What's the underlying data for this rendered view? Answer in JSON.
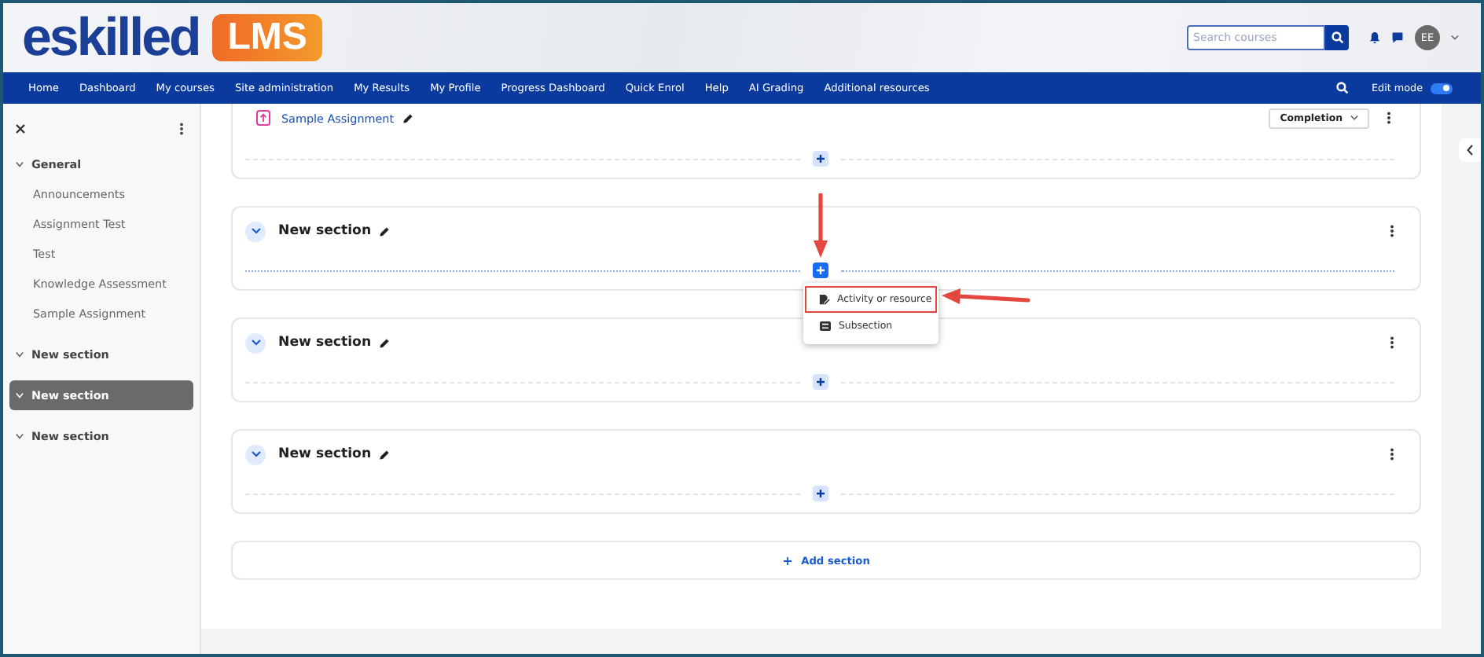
{
  "header": {
    "logo_text": "eskilled",
    "logo_badge": "LMS",
    "search": {
      "placeholder": "Search courses"
    },
    "avatar": "EE"
  },
  "nav": {
    "items": [
      "Home",
      "Dashboard",
      "My courses",
      "Site administration",
      "My Results",
      "My Profile",
      "Progress Dashboard",
      "Quick Enrol",
      "Help",
      "AI Grading",
      "Additional resources"
    ],
    "edit_mode": {
      "label": "Edit mode",
      "on": true
    }
  },
  "sidebar": {
    "items": [
      {
        "label": "General",
        "expanded": true,
        "selected": false,
        "children": [
          {
            "label": "Announcements"
          },
          {
            "label": "Assignment Test"
          },
          {
            "label": "Test"
          },
          {
            "label": "Knowledge Assessment"
          },
          {
            "label": "Sample Assignment"
          }
        ]
      },
      {
        "label": "New section",
        "expanded": true,
        "selected": false
      },
      {
        "label": "New section",
        "expanded": true,
        "selected": true
      },
      {
        "label": "New section",
        "expanded": true,
        "selected": false
      }
    ]
  },
  "sections": [
    {
      "activities": [
        {
          "name": "Sample Assignment",
          "completion": "Completion"
        }
      ],
      "add_active": false
    },
    {
      "title": "New section",
      "add_active": true,
      "menu": [
        {
          "label": "Activity or resource",
          "kind": "activity",
          "highlighted": true
        },
        {
          "label": "Subsection",
          "kind": "subsection",
          "highlighted": false
        }
      ]
    },
    {
      "title": "New section",
      "add_active": false
    },
    {
      "title": "New section",
      "add_active": false
    }
  ],
  "add_section": "Add section"
}
